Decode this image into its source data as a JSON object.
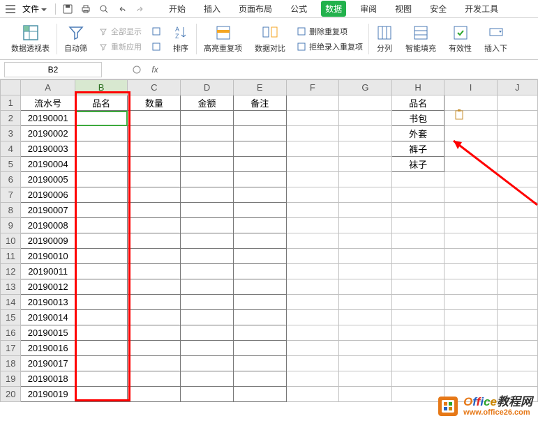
{
  "menubar": {
    "file": "文件",
    "tabs": [
      "开始",
      "插入",
      "页面布局",
      "公式",
      "数据",
      "审阅",
      "视图",
      "安全",
      "开发工具"
    ],
    "active_tab": "数据"
  },
  "ribbon": {
    "pivot": "数据透视表",
    "filter": "自动筛",
    "show_all": "全部显示",
    "reapply": "重新应用",
    "sort": "排序",
    "highlight_dup": "高亮重复项",
    "data_compare": "数据对比",
    "delete_dup": "删除重复项",
    "reject_dup": "拒绝录入重复项",
    "text_to_col": "分列",
    "smart_fill": "智能填充",
    "validation": "有效性",
    "insert_dropdown": "插入下"
  },
  "namebox": "B2",
  "fx_label": "fx",
  "columns": [
    "A",
    "B",
    "C",
    "D",
    "E",
    "F",
    "G",
    "H",
    "I",
    "J"
  ],
  "headers": {
    "A": "流水号",
    "B": "品名",
    "C": "数量",
    "D": "金额",
    "E": "备注",
    "H": "品名"
  },
  "colA": [
    "20190001",
    "20190002",
    "20190003",
    "20190004",
    "20190005",
    "20190006",
    "20190007",
    "20190008",
    "20190009",
    "20190010",
    "20190011",
    "20190012",
    "20190013",
    "20190014",
    "20190015",
    "20190016",
    "20190017",
    "20190018",
    "20190019"
  ],
  "colH": [
    "书包",
    "外套",
    "裤子",
    "袜子"
  ],
  "watermark": {
    "text": "Office教程网",
    "url": "www.office26.com"
  }
}
